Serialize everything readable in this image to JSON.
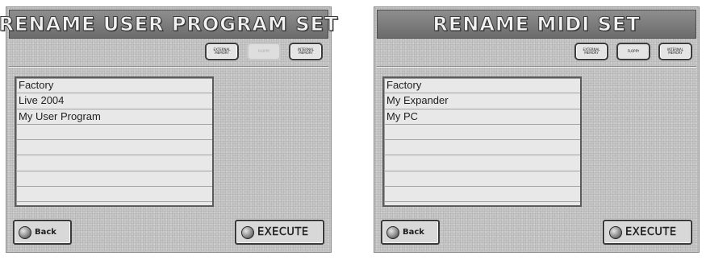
{
  "screens": [
    {
      "title": "RENAME USER PROGRAM SET",
      "tabs": [
        {
          "label": "EXTERNAL MEMORY",
          "state": "active"
        },
        {
          "label": "FLOPPY",
          "state": "dim"
        },
        {
          "label": "INTERNAL MEMORY",
          "state": "active"
        }
      ],
      "items": [
        "Factory",
        "Live 2004",
        "My User Program",
        "",
        "",
        "",
        "",
        ""
      ],
      "back_label": "Back",
      "execute_label": "EXECUTE"
    },
    {
      "title": "RENAME MIDI SET",
      "tabs": [
        {
          "label": "EXTERNAL MEMORY",
          "state": "active"
        },
        {
          "label": "FLOPPY",
          "state": "plain"
        },
        {
          "label": "INTERNAL MEMORY",
          "state": "active"
        }
      ],
      "items": [
        "Factory",
        "My Expander",
        "My PC",
        "",
        "",
        "",
        "",
        ""
      ],
      "back_label": "Back",
      "execute_label": "EXECUTE"
    }
  ],
  "colors": {
    "panel_bg": "#c8c8c8",
    "title_bar": "#7a7a7a",
    "list_bg": "#e8e8e8"
  },
  "icons": {
    "button_knob": "knob-icon"
  }
}
